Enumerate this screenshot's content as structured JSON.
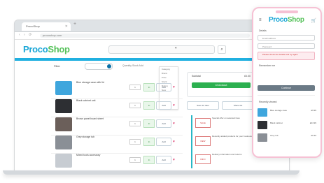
{
  "colors": {
    "brand_blue": "#1aa6d6",
    "brand_green": "#56c25b",
    "accent_cyan": "#20b0e0",
    "checkout_green": "#2cb050",
    "phone_pink": "#f6c1d4"
  },
  "browser": {
    "tab_label": "ProcoShop",
    "url": "procoshop.com"
  },
  "site": {
    "logo_a": "Proco",
    "logo_b": "Shop",
    "search_dropdown": "▾",
    "filter_label": "Filter",
    "column_header": "Quantity  Stock  Add",
    "dropdown_items": [
      "Category",
      "Brand",
      "Price",
      "Stock",
      "Rating",
      "New"
    ]
  },
  "products": [
    {
      "name": "Blue storage case with lid",
      "qty": "1",
      "stock": "In",
      "btn": "Add",
      "thumb_color": "#3fa6dd"
    },
    {
      "name": "Black cabinet unit",
      "qty": "1",
      "stock": "In",
      "btn": "Add",
      "thumb_color": "#2d2f33"
    },
    {
      "name": "Brown panel board sheet",
      "qty": "1",
      "stock": "In",
      "btn": "Add",
      "thumb_color": "#6b5f5a"
    },
    {
      "name": "Grey storage tub",
      "qty": "1",
      "stock": "In",
      "btn": "Add",
      "thumb_color": "#8a8f96"
    },
    {
      "name": "Mixed tools accessory",
      "qty": "1",
      "stock": "In",
      "btn": "Add",
      "thumb_color": "#c7ccd2"
    }
  ],
  "cart": {
    "subtotal_label": "Subtotal",
    "subtotal_value": "£0.00",
    "checkout_label": "Checkout",
    "btn_left": "Save for later",
    "btn_right": "Share list"
  },
  "promos": [
    {
      "tag": "SALE",
      "text": "Special offer on selected lines"
    },
    {
      "tag": "NEW",
      "text": "Recently added products for your business"
    },
    {
      "tag": "INFO",
      "text": "Delivery information and returns"
    }
  ],
  "phone": {
    "logo_a": "Proco",
    "logo_b": "Shop",
    "menu_icon": "≡",
    "cart_icon": "🛒",
    "section_title": "Details",
    "field1": "Email address",
    "field2": "Password",
    "field3": "Please check the details and try again",
    "link": "Remember me",
    "button": "Continue",
    "list_title": "Recently viewed",
    "items": [
      {
        "title": "Blue storage case",
        "price": "£9.99",
        "color": "#3fa6dd"
      },
      {
        "title": "Black cabinet",
        "price": "£24.99",
        "color": "#2d2f33"
      },
      {
        "title": "Grey tub",
        "price": "£6.49",
        "color": "#8a8f96"
      }
    ]
  }
}
